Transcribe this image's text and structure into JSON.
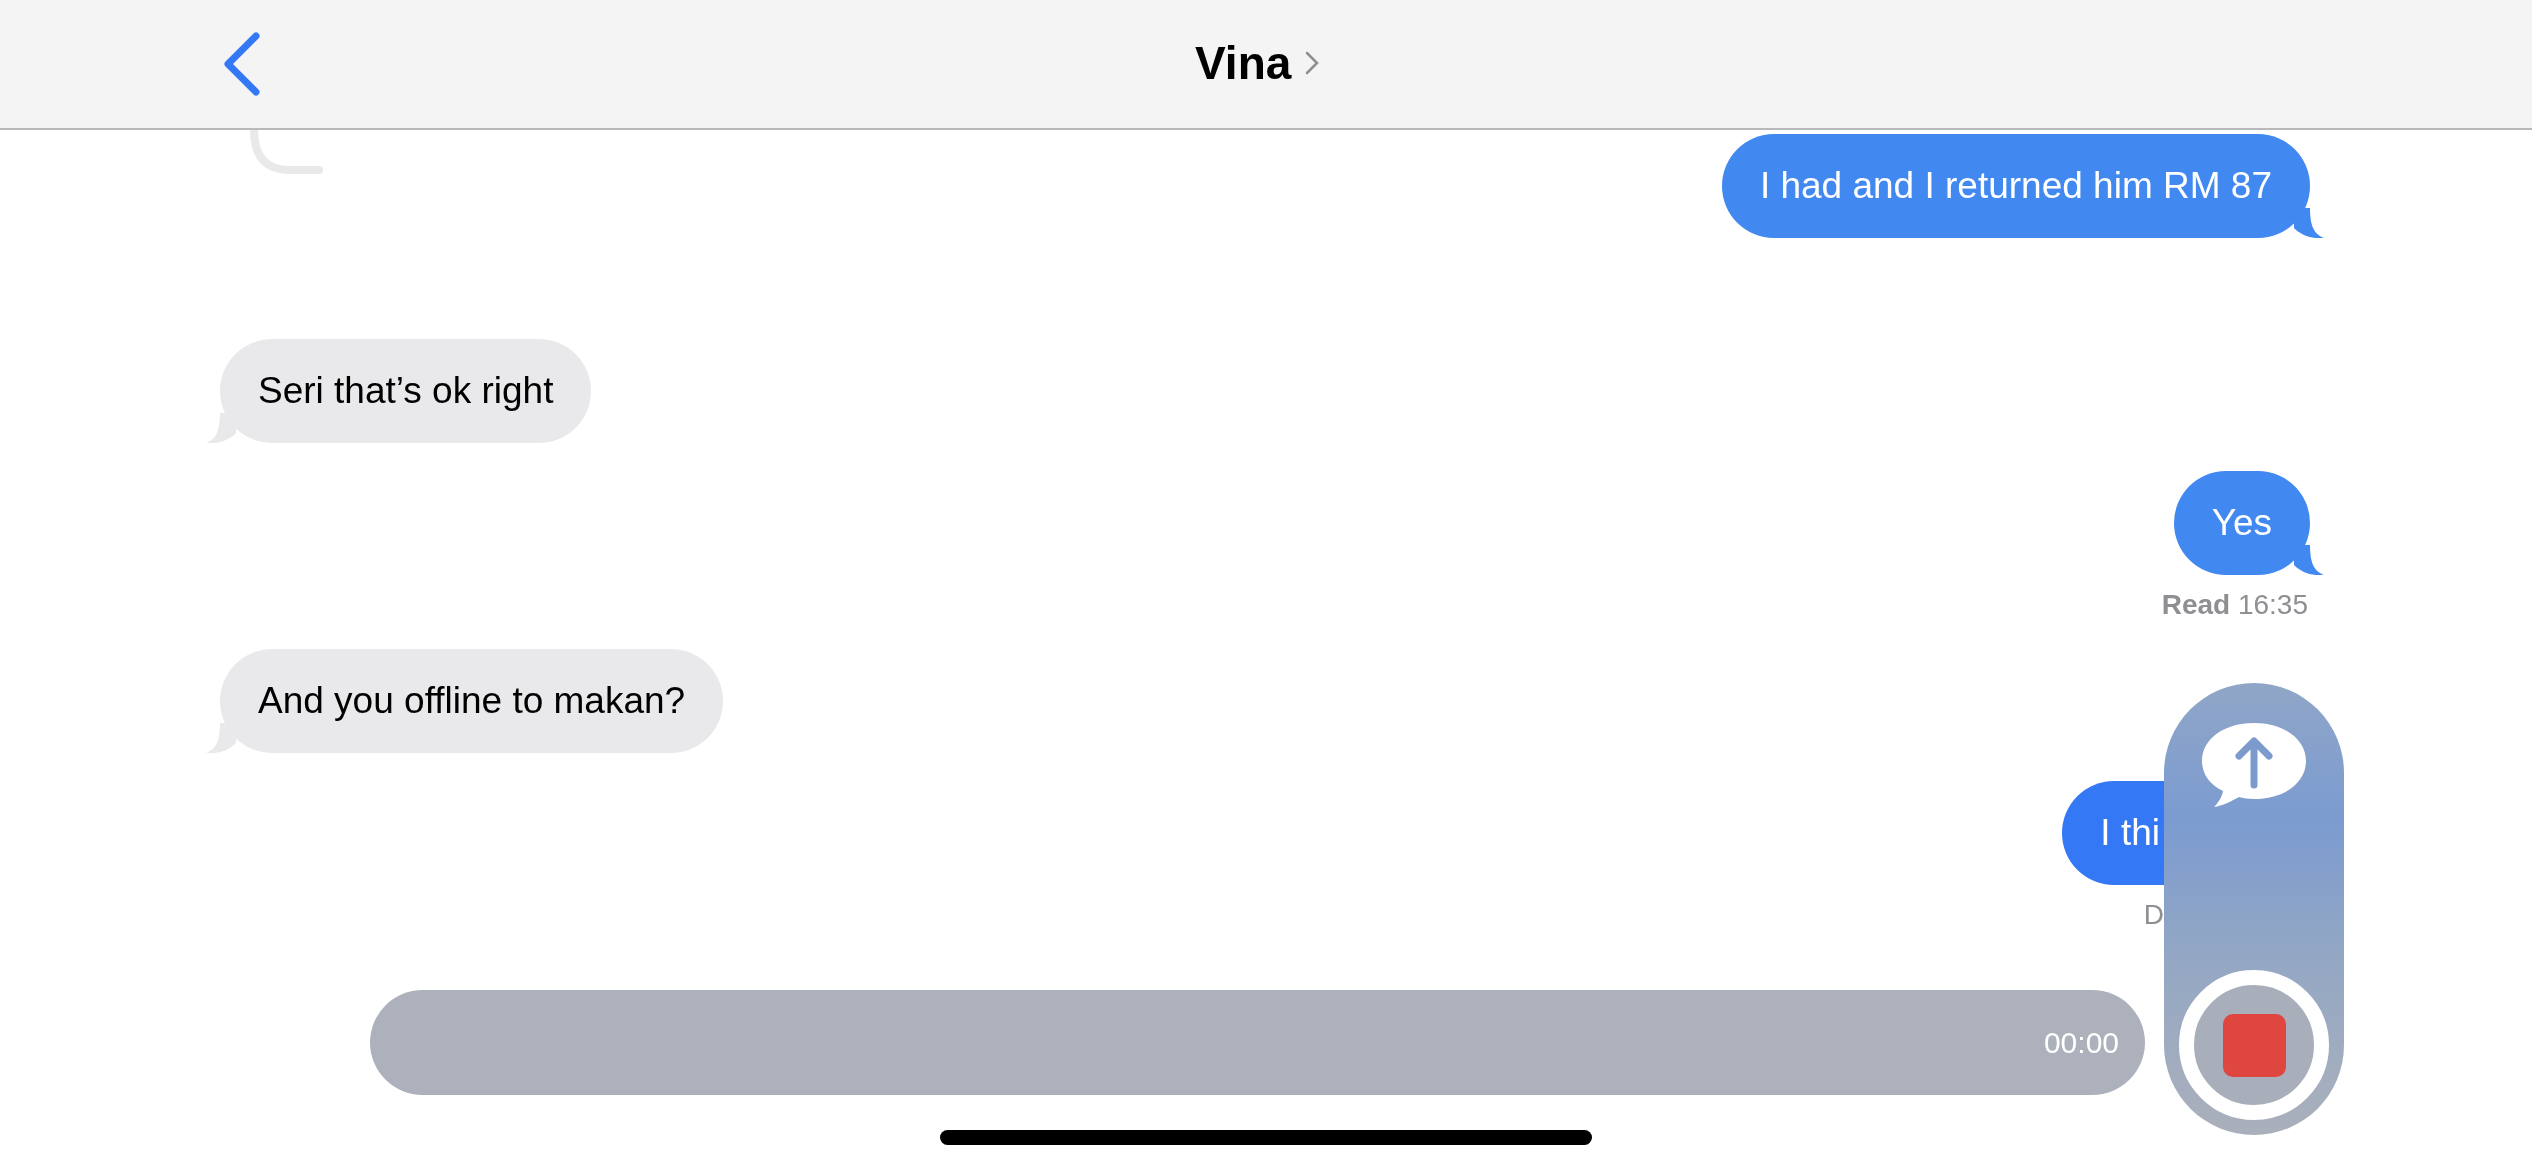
{
  "header": {
    "title": "Vina"
  },
  "messages": [
    {
      "kind": "sent",
      "text": "I had and I returned him RM 87"
    },
    {
      "kind": "received",
      "text": "Seri that’s ok right"
    },
    {
      "kind": "sent",
      "text": "Yes",
      "receipt": "**Read** 16:35"
    },
    {
      "kind": "received",
      "text": "And you offline to makan?"
    },
    {
      "kind": "sent",
      "text": "I thi",
      "receipt": "D"
    }
  ],
  "recorder": {
    "timer": "00:00"
  }
}
